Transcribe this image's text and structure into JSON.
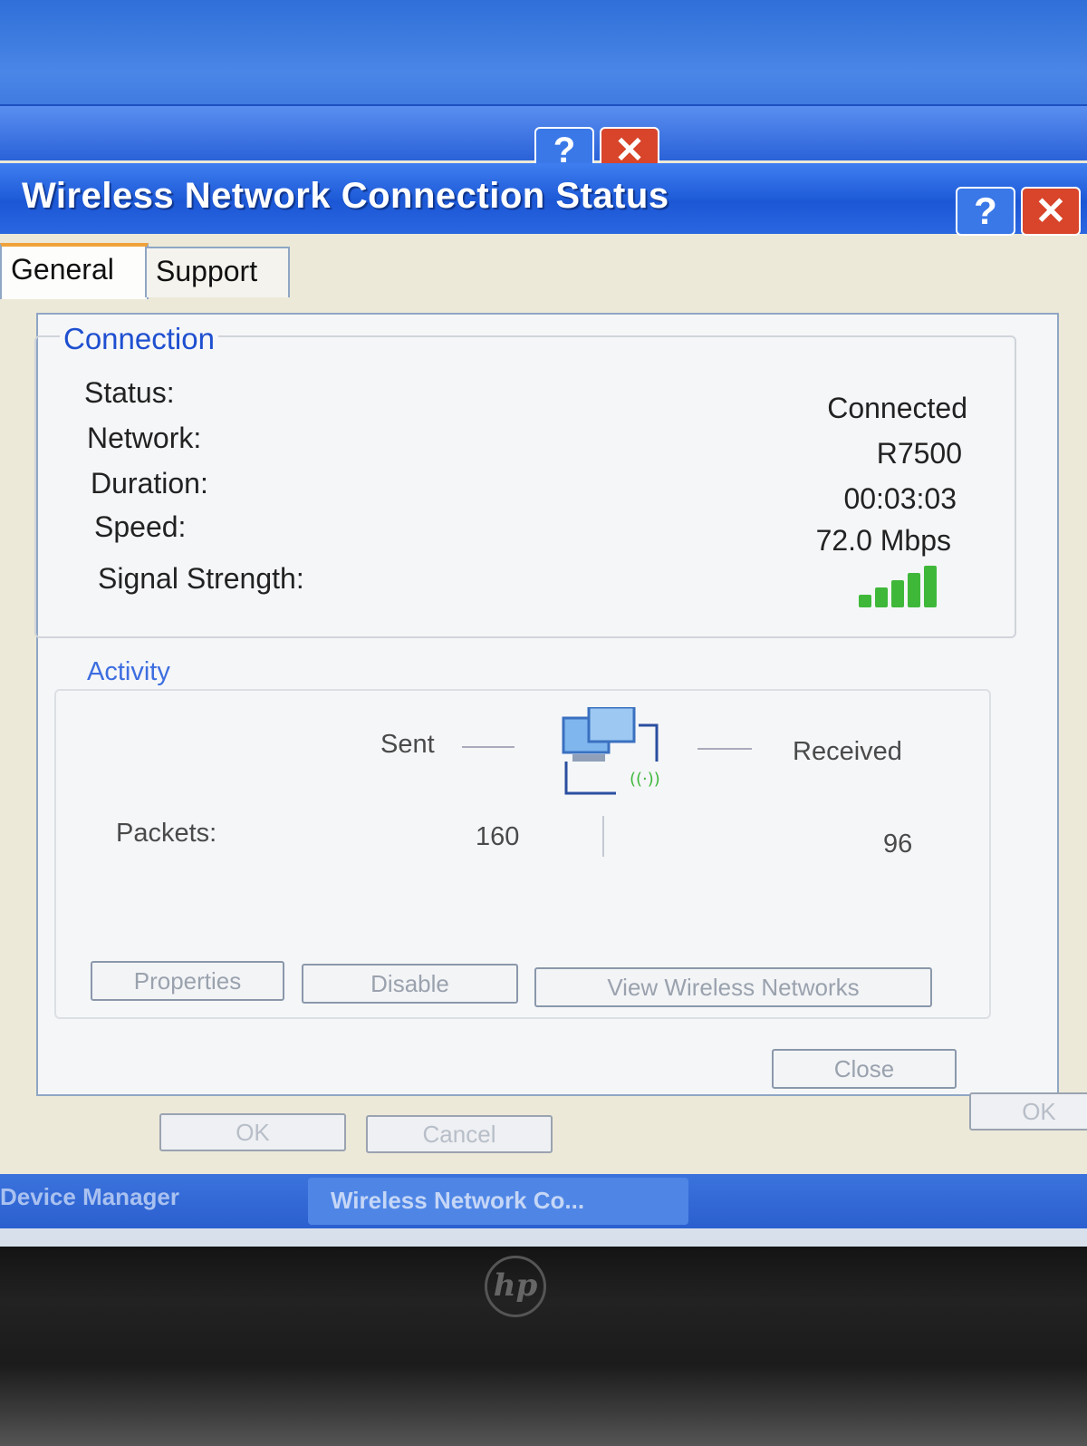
{
  "dialog": {
    "title": "Wireless Network Connection Status",
    "help_glyph": "?",
    "close_glyph": "✕"
  },
  "tabs": [
    {
      "label": "General",
      "active": true
    },
    {
      "label": "Support",
      "active": false
    }
  ],
  "connection": {
    "group_label": "Connection",
    "status_label": "Status:",
    "status_value": "Connected",
    "network_label": "Network:",
    "network_value": "R7500",
    "duration_label": "Duration:",
    "duration_value": "00:03:03",
    "speed_label": "Speed:",
    "speed_value": "72.0 Mbps",
    "signal_label": "Signal Strength:",
    "signal_bars": 5,
    "signal_color": "#3fb83a"
  },
  "activity": {
    "group_label": "Activity",
    "sent_label": "Sent",
    "received_label": "Received",
    "packets_label": "Packets:",
    "packets_sent": "160",
    "packets_received": "96"
  },
  "buttons": {
    "properties": "Properties",
    "disable": "Disable",
    "view_networks": "View Wireless Networks",
    "close": "Close"
  },
  "background_window": {
    "ok": "OK",
    "cancel": "Cancel",
    "ok_right": "OK"
  },
  "taskbar": {
    "item1": "Device Manager",
    "item2": "Wireless Network Co..."
  },
  "laptop": {
    "logo": "hp"
  }
}
